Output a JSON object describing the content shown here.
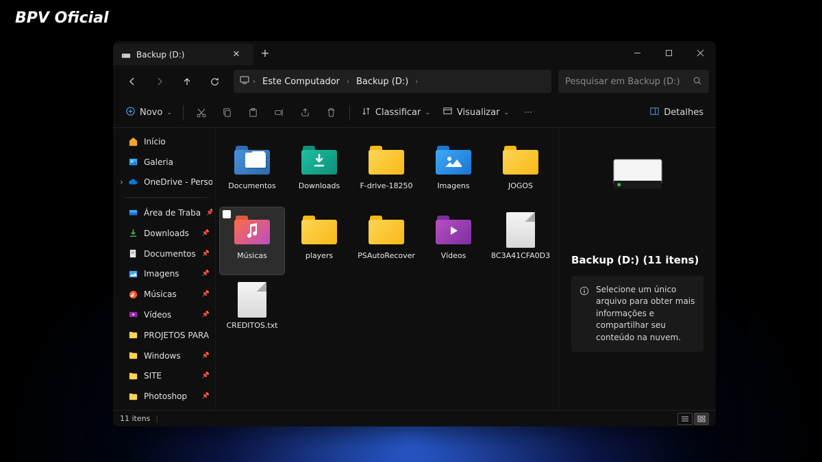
{
  "watermark": "BPV Oficial",
  "tab": {
    "title": "Backup (D:)"
  },
  "breadcrumb": [
    "Este Computador",
    "Backup (D:)"
  ],
  "search": {
    "placeholder": "Pesquisar em Backup (D:)"
  },
  "toolbar": {
    "new": "Novo",
    "sort": "Classificar",
    "view": "Visualizar",
    "details": "Detalhes"
  },
  "sidebar": {
    "top": [
      {
        "label": "Início",
        "icon": "home"
      },
      {
        "label": "Galeria",
        "icon": "gallery"
      },
      {
        "label": "OneDrive - Perso",
        "icon": "onedrive",
        "expandable": true
      }
    ],
    "pinned": [
      {
        "label": "Área de Traba",
        "icon": "desktop"
      },
      {
        "label": "Downloads",
        "icon": "download"
      },
      {
        "label": "Documentos",
        "icon": "document"
      },
      {
        "label": "Imagens",
        "icon": "image"
      },
      {
        "label": "Músicas",
        "icon": "music"
      },
      {
        "label": "Vídeos",
        "icon": "video"
      },
      {
        "label": "PROJETOS PARA",
        "icon": "folder"
      },
      {
        "label": "Windows",
        "icon": "folder"
      },
      {
        "label": "SITE",
        "icon": "folder"
      },
      {
        "label": "Photoshop",
        "icon": "folder"
      }
    ]
  },
  "items": [
    {
      "label": "Documentos",
      "type": "folder-docs"
    },
    {
      "label": "Downloads",
      "type": "folder-dl"
    },
    {
      "label": "F-drive-18250",
      "type": "folder-yellow"
    },
    {
      "label": "Imagens",
      "type": "folder-img"
    },
    {
      "label": "JOGOS",
      "type": "folder-yellow"
    },
    {
      "label": "Músicas",
      "type": "folder-mus",
      "selected": true
    },
    {
      "label": "players",
      "type": "folder-yellow"
    },
    {
      "label": "PSAutoRecover",
      "type": "folder-yellow"
    },
    {
      "label": "Vídeos",
      "type": "folder-vid"
    },
    {
      "label": "8C3A41CFA0D3",
      "type": "file"
    },
    {
      "label": "CREDITOS.txt",
      "type": "file"
    }
  ],
  "detailsPane": {
    "title": "Backup (D:) (11 itens)",
    "info": "Selecione um único arquivo para obter mais informações e compartilhar seu conteúdo na nuvem."
  },
  "statusbar": {
    "count": "11 itens"
  }
}
